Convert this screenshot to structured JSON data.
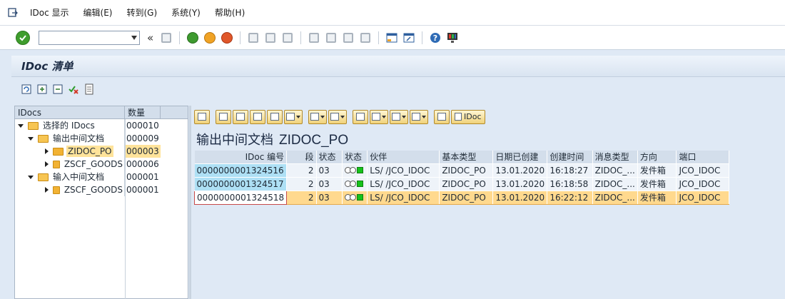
{
  "menubar": {
    "items": [
      {
        "label": "IDoc 显示",
        "underline": ""
      },
      {
        "label": "编辑(E)"
      },
      {
        "label": "转到(G)"
      },
      {
        "label": "系统(Y)"
      },
      {
        "label": "帮助(H)"
      }
    ]
  },
  "toolbar": {
    "command_field_value": "",
    "collapse_symbol": "«"
  },
  "screen": {
    "title": "IDoc 清单"
  },
  "tree": {
    "headers": {
      "name": "IDocs",
      "count": "数量"
    },
    "rows": [
      {
        "label": "选择的 IDocs",
        "count": "000010"
      },
      {
        "label": "输出中间文档",
        "count": "000009"
      },
      {
        "label": "ZIDOC_PO",
        "count": "000003"
      },
      {
        "label": "ZSCF_GOODS",
        "count": "000006"
      },
      {
        "label": "输入中间文档",
        "count": "000001"
      },
      {
        "label": "ZSCF_GOODS",
        "count": "000001"
      }
    ]
  },
  "alv": {
    "idoc_button_label": "IDoc",
    "title_prefix": "输出中间文档",
    "title_doc": "ZIDOC_PO",
    "columns": [
      "IDoc 编号",
      "段",
      "状态",
      "状态",
      "伙伴",
      "基本类型",
      "日期已创建",
      "创建时间",
      "消息类型",
      "方向",
      "端口"
    ],
    "rows": [
      {
        "idoc": "0000000001324516",
        "seg": "2",
        "status": "03",
        "partner": "LS/  /JCO_IDOC",
        "basic_type": "ZIDOC_PO",
        "date": "13.01.2020",
        "time": "16:18:27",
        "msg_type": "ZIDOC_...",
        "direction": "发件箱",
        "port": "JCO_IDOC"
      },
      {
        "idoc": "0000000001324517",
        "seg": "2",
        "status": "03",
        "partner": "LS/  /JCO_IDOC",
        "basic_type": "ZIDOC_PO",
        "date": "13.01.2020",
        "time": "16:18:58",
        "msg_type": "ZIDOC_...",
        "direction": "发件箱",
        "port": "JCO_IDOC"
      },
      {
        "idoc": "0000000001324518",
        "seg": "2",
        "status": "03",
        "partner": "LS/  /JCO_IDOC",
        "basic_type": "ZIDOC_PO",
        "date": "13.01.2020",
        "time": "16:22:12",
        "msg_type": "ZIDOC_...",
        "direction": "发件箱",
        "port": "JCO_IDOC"
      }
    ]
  }
}
